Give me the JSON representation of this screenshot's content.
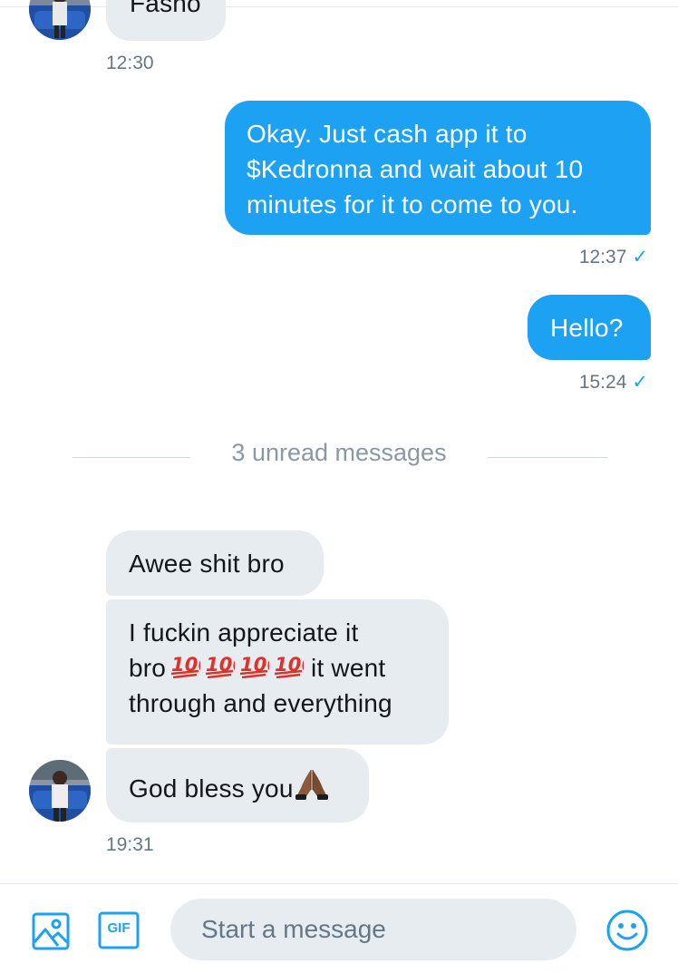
{
  "conversation": {
    "messages": [
      {
        "id": "m0",
        "direction": "incoming",
        "text": "Fasho",
        "clipped": true
      },
      {
        "id": "m1",
        "direction": "outgoing",
        "lines": [
          "Okay. Just cash app it to",
          "$Kedronna and wait about 10",
          "minutes for it to come to you."
        ]
      },
      {
        "id": "m2",
        "direction": "outgoing",
        "text": "Hello?"
      },
      {
        "id": "m3",
        "direction": "incoming",
        "text": "Awee shit bro"
      },
      {
        "id": "m4",
        "direction": "incoming",
        "line1": "I fuckin appreciate it",
        "line2_pre": "bro",
        "line2_post": " it went",
        "line3": "through and everything",
        "emoji": "💯💯💯💯",
        "emoji_icons": [
          "hundred-points-icon",
          "hundred-points-icon",
          "hundred-points-icon",
          "hundred-points-icon"
        ]
      },
      {
        "id": "m5",
        "direction": "incoming",
        "text": "God bless you",
        "emoji": "🙏🏾",
        "emoji_icon": "folded-hands-icon"
      }
    ],
    "timestamps": {
      "t1": "12:30",
      "t2": "12:37",
      "t3": "15:24",
      "t4": "19:31"
    },
    "read_receipt": "✓",
    "unread_divider": "3 unread messages"
  },
  "composer": {
    "placeholder": "Start a message",
    "media_icon": "image-icon",
    "gif_icon": "gif-icon",
    "gif_label": "GIF",
    "emoji_icon": "smiley-icon"
  },
  "colors": {
    "accent": "#1da1f2",
    "incoming_bubble": "#e6ecf0",
    "timestamp": "#657786",
    "divider_text": "#8899a6"
  }
}
